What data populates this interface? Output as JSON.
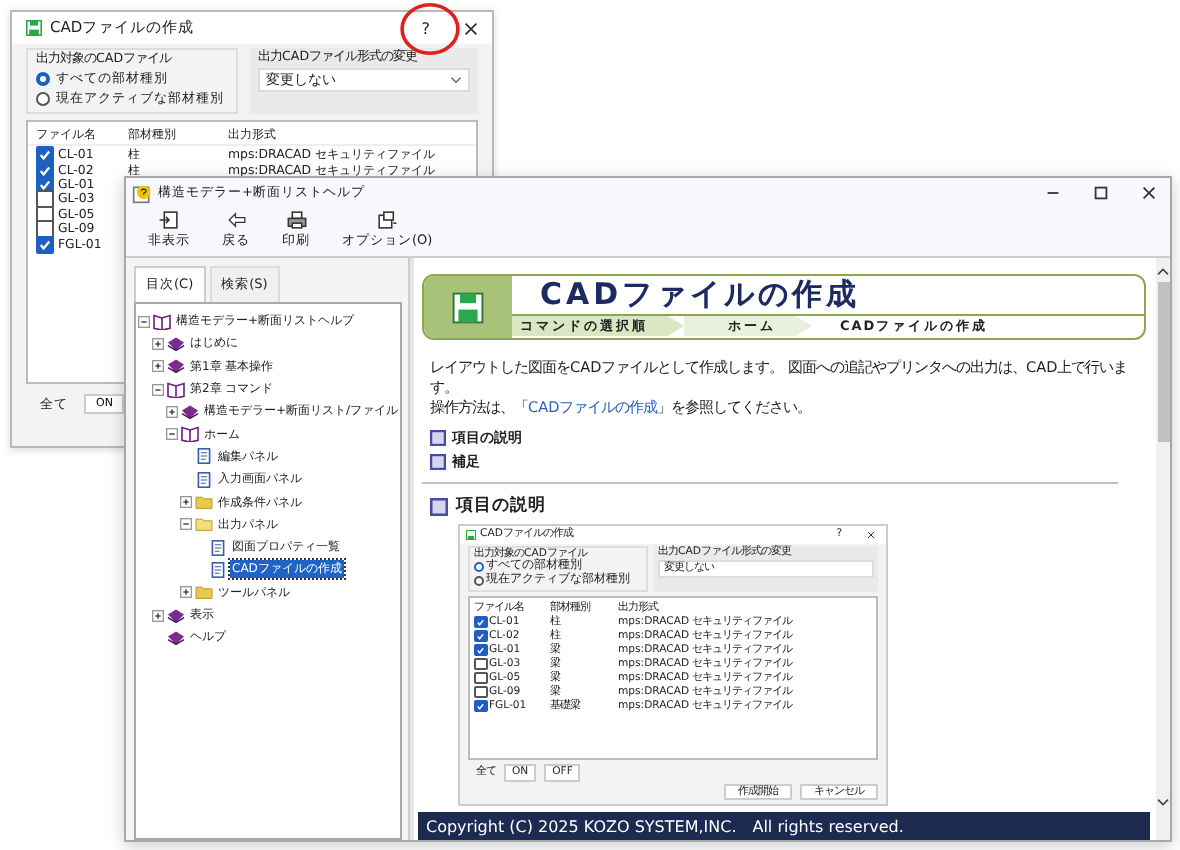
{
  "background_dialog": {
    "title": "CADファイルの作成",
    "help_button": "?",
    "target_group": {
      "label": "出力対象のCADファイル",
      "options": [
        {
          "label": "すべての部材種別",
          "selected": true
        },
        {
          "label": "現在アクティブな部材種別",
          "selected": false
        }
      ]
    },
    "format_group": {
      "label": "出力CADファイル形式の変更",
      "value": "変更しない"
    },
    "columns": [
      "ファイル名",
      "部材種別",
      "出力形式"
    ],
    "rows": [
      {
        "checked": true,
        "file": "CL-01",
        "type": "柱",
        "format": "mps:DRACAD セキュリティファイル"
      },
      {
        "checked": true,
        "file": "CL-02",
        "type": "柱",
        "format": "mps:DRACAD セキュリティファイル"
      },
      {
        "checked": true,
        "file": "GL-01"
      },
      {
        "checked": false,
        "file": "GL-03"
      },
      {
        "checked": false,
        "file": "GL-05"
      },
      {
        "checked": false,
        "file": "GL-09"
      },
      {
        "checked": true,
        "file": "FGL-01"
      }
    ],
    "all_label": "全て",
    "on_button": "ON"
  },
  "help_window": {
    "title": "構造モデラー+断面リストヘルプ",
    "toolbar": [
      {
        "kind": "hide",
        "label": "非表示"
      },
      {
        "kind": "back",
        "label": "戻る"
      },
      {
        "kind": "print",
        "label": "印刷"
      },
      {
        "kind": "options",
        "label": "オプション(O)"
      }
    ],
    "tabs": [
      {
        "label": "目次(C)",
        "selected": true
      },
      {
        "label": "検索(S)",
        "selected": false
      }
    ],
    "tree": [
      {
        "kind": "book",
        "label": "構造モデラー+断面リストヘルプ",
        "expanded": true,
        "selected": false,
        "children": [
          {
            "kind": "book",
            "label": "はじめに",
            "expanded": false,
            "selected": false
          },
          {
            "kind": "book",
            "label": "第1章 基本操作",
            "expanded": false,
            "selected": false
          },
          {
            "kind": "book",
            "label": "第2章 コマンド",
            "expanded": true,
            "selected": false,
            "children": [
              {
                "kind": "book",
                "label": "構造モデラー+断面リスト/ファイル",
                "expanded": false,
                "selected": false
              },
              {
                "kind": "book",
                "label": "ホーム",
                "expanded": true,
                "selected": false,
                "children": [
                  {
                    "kind": "page",
                    "label": "編集パネル",
                    "selected": false
                  },
                  {
                    "kind": "page",
                    "label": "入力画面パネル",
                    "selected": false
                  },
                  {
                    "kind": "folder",
                    "label": "作成条件パネル",
                    "expanded": false,
                    "selected": false
                  },
                  {
                    "kind": "folder",
                    "label": "出力パネル",
                    "expanded": true,
                    "selected": false,
                    "children": [
                      {
                        "kind": "page",
                        "label": "図面プロパティ一覧",
                        "selected": false
                      },
                      {
                        "kind": "page",
                        "label": "CADファイルの作成",
                        "selected": true
                      }
                    ]
                  },
                  {
                    "kind": "folder",
                    "label": "ツールパネル",
                    "expanded": false,
                    "selected": false
                  }
                ]
              }
            ]
          },
          {
            "kind": "book",
            "label": "表示",
            "expanded": false,
            "selected": false
          },
          {
            "kind": "book",
            "label": "ヘルプ",
            "selected": false
          }
        ]
      }
    ],
    "content": {
      "banner": {
        "title": "CADファイルの作成",
        "breadcrumb": [
          "コマンドの選択順",
          "ホーム",
          "CADファイルの作成"
        ]
      },
      "description": "レイアウトした図面をCADファイルとして作成します。 図面への追記やプリンタへの出力は、CAD上で行います。",
      "instruction": {
        "before": "操作方法は、「",
        "link": "CADファイルの作成",
        "after": "」を参照してください。"
      },
      "links": [
        "項目の説明",
        "補足"
      ],
      "section_heading": "項目の説明",
      "screenshot": {
        "title": "CADファイルの作成",
        "help_button": "?",
        "target_group": {
          "label": "出力対象のCADファイル",
          "options": [
            {
              "label": "すべての部材種別",
              "selected": true
            },
            {
              "label": "現在アクティブな部材種別",
              "selected": false
            }
          ]
        },
        "format_group": {
          "label": "出力CADファイル形式の変更",
          "value": "変更しない"
        },
        "columns": [
          "ファイル名",
          "部材種別",
          "出力形式"
        ],
        "rows": [
          {
            "checked": true,
            "file": "CL-01",
            "type": "柱",
            "format": "mps:DRACAD セキュリティファイル"
          },
          {
            "checked": true,
            "file": "CL-02",
            "type": "柱",
            "format": "mps:DRACAD セキュリティファイル"
          },
          {
            "checked": true,
            "file": "GL-01",
            "type": "梁",
            "format": "mps:DRACAD セキュリティファイル"
          },
          {
            "checked": false,
            "file": "GL-03",
            "type": "梁",
            "format": "mps:DRACAD セキュリティファイル"
          },
          {
            "checked": false,
            "file": "GL-05",
            "type": "梁",
            "format": "mps:DRACAD セキュリティファイル"
          },
          {
            "checked": false,
            "file": "GL-09",
            "type": "梁",
            "format": "mps:DRACAD セキュリティファイル"
          },
          {
            "checked": true,
            "file": "FGL-01",
            "type": "基礎梁",
            "format": "mps:DRACAD セキュリティファイル"
          }
        ],
        "all_label": "全て",
        "toggle_buttons": [
          "ON",
          "OFF"
        ],
        "action_buttons": [
          "作成開始",
          "キャンセル"
        ]
      },
      "footer": "Copyright (C) 2025 KOZO SYSTEM,INC.　All rights reserved."
    }
  }
}
